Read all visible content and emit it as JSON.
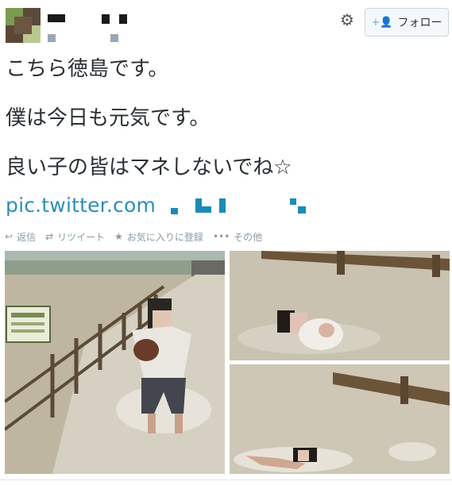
{
  "header": {
    "follow_label": "フォロー",
    "gear_icon": "gear-icon",
    "follow_icon": "person-plus-icon"
  },
  "tweet": {
    "lines": [
      "こちら徳島です。",
      "",
      "僕は今日も元気です。",
      "",
      "良い子の皆はマネしないでね☆"
    ],
    "link_text": "pic.twitter.com",
    "link_color": "#2a8fb8"
  },
  "actions": [
    {
      "label": "返信",
      "icon": "reply-icon"
    },
    {
      "label": "リツイート",
      "icon": "retweet-icon"
    },
    {
      "label": "お気に入りに登録",
      "icon": "star-icon"
    },
    {
      "label": "その他",
      "icon": "more-icon"
    }
  ],
  "media": {
    "count": 3
  }
}
